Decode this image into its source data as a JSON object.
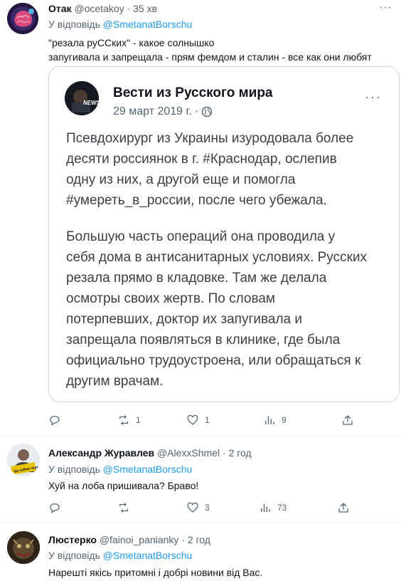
{
  "tweets": [
    {
      "name": "Отак",
      "handle": "@ocetakoy",
      "time": "35 хв",
      "reply_prefix": "У відповідь",
      "reply_to": "@SmetanatBorschu",
      "text_lines": [
        "\"резала руССких\" - какое солнышко",
        "запугивала и запрещала - прям фемдом и сталин - все как они любят"
      ],
      "quote": {
        "name": "Вести из Русского мира",
        "date": "29 март 2019 г.",
        "avatar_text": "NEWS",
        "paragraph1": [
          "Псевдохирург из Украины изуродовала более",
          "десяти россиянок в г. #Краснодар, ослепив",
          "одну из них, а другой еще и помогла",
          "#умереть_в_россии, после чего убежала."
        ],
        "paragraph2": [
          "Большую часть операций она проводила у",
          "себя дома в антисанитарных условиях. Русских",
          "резала прямо в кладовке. Там же делала",
          "осмотры своих жертв. По словам",
          "потерпевших, доктор их запугивала и",
          "запрещала появляться в клинике, где была",
          "официально трудоустроена, или обращаться к",
          "другим врачам."
        ]
      },
      "actions": {
        "reply": "",
        "retweet": "1",
        "like": "1",
        "views": "9"
      }
    },
    {
      "name": "Александр Журавлев",
      "handle": "@AlexxShmel",
      "time": "2 год",
      "reply_prefix": "У відповідь",
      "reply_to": "@SmetanatBorschu",
      "avatar_text": "Ца хуйна черопиздиться!",
      "text_lines": [
        "Хуй на лоба пришивала? Браво!"
      ],
      "actions": {
        "reply": "",
        "retweet": "",
        "like": "3",
        "views": "73"
      }
    },
    {
      "name": "Люстерко",
      "handle": "@fainoi_panianky",
      "time": "2 год",
      "reply_prefix": "У відповідь",
      "reply_to": "@SmetanatBorschu",
      "text_lines": [
        "Нарешті якісь притомні і добрі новини від Вас."
      ]
    }
  ],
  "colors": {
    "link": "#1d9bf0",
    "muted": "#536471",
    "text": "#0f1419"
  }
}
